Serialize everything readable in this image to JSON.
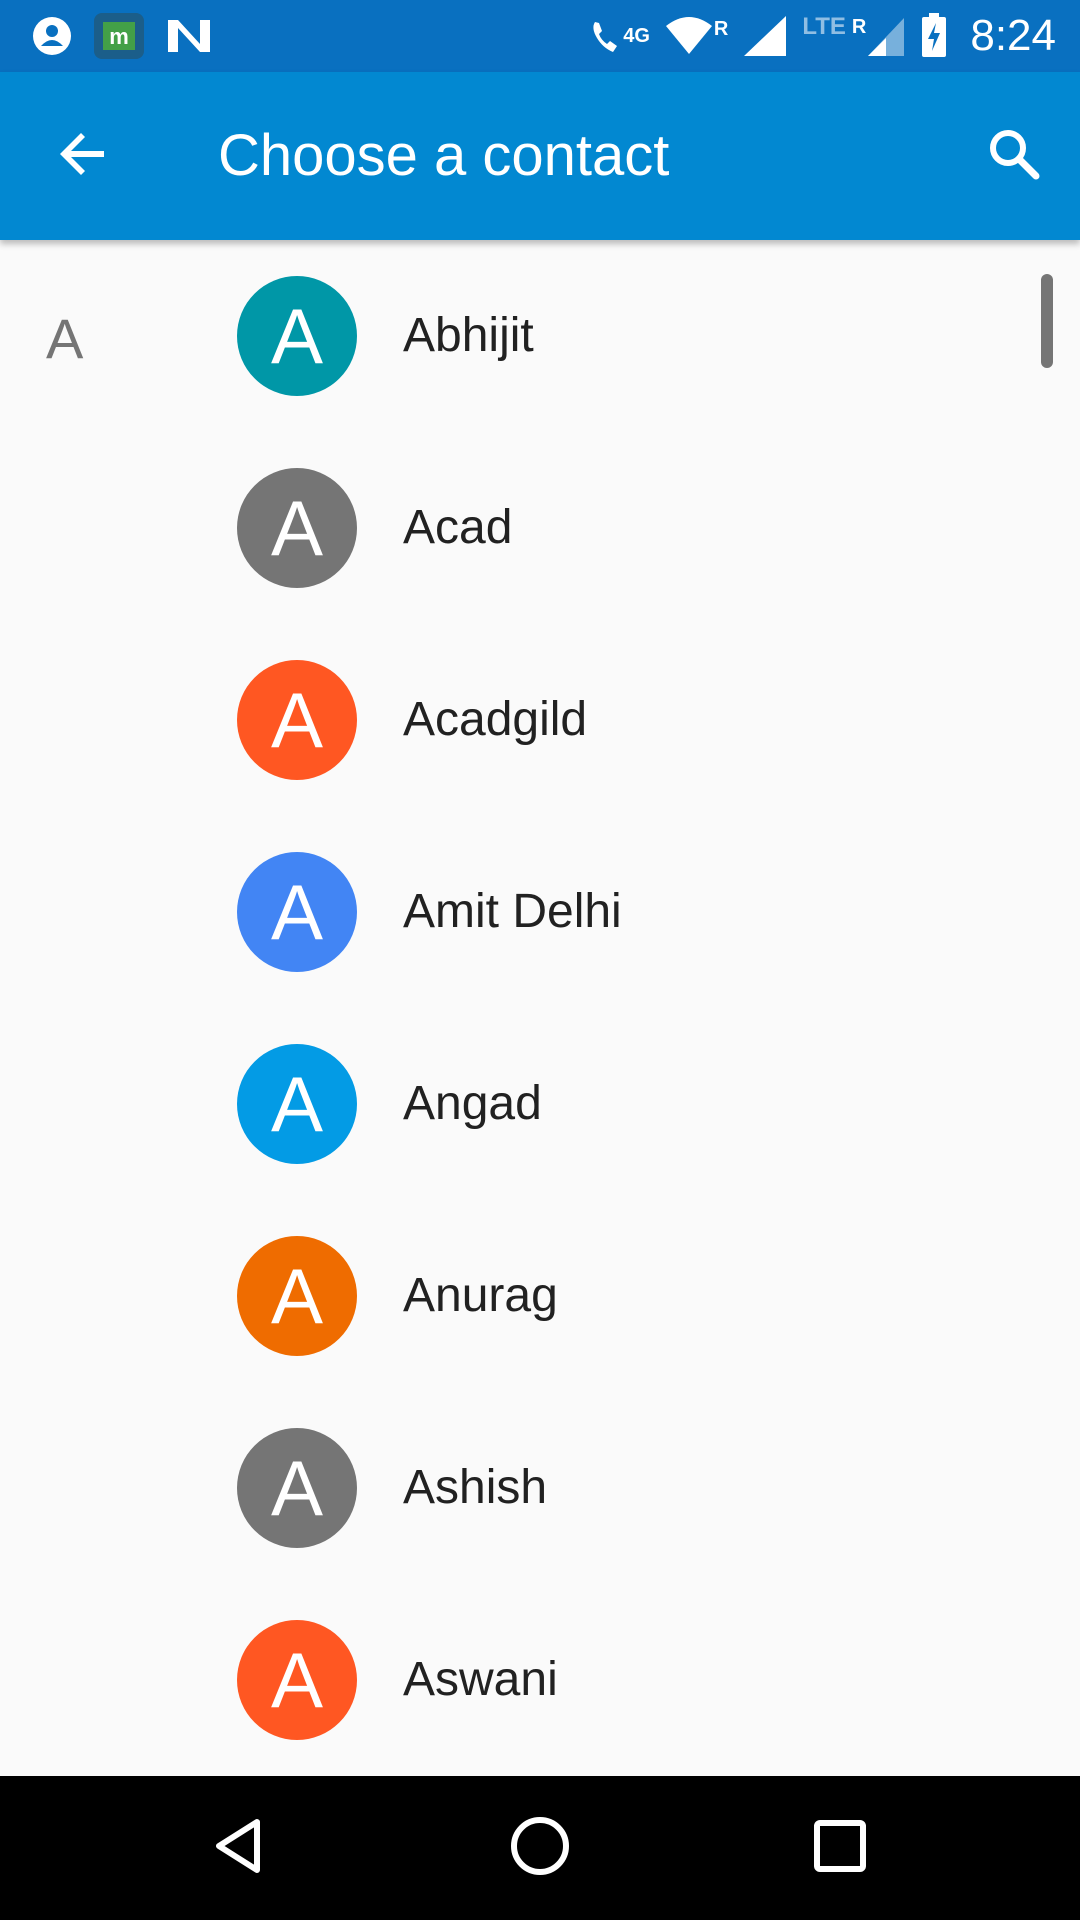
{
  "status_bar": {
    "time": "8:24",
    "network_label": "4G",
    "wifi_roaming": "R",
    "lte_label": "LTE",
    "cell_roaming": "R",
    "left_icons": [
      "account-circle-icon",
      "m-app-icon",
      "n-app-icon"
    ],
    "right_icons": [
      "wifi-calling-icon",
      "wifi-icon",
      "signal-icon",
      "lte-signal-icon",
      "battery-charging-icon"
    ]
  },
  "app_bar": {
    "title": "Choose a contact",
    "back_icon": "arrow-back-icon",
    "search_icon": "search-icon",
    "color": "#0288d1"
  },
  "section": {
    "letter": "A"
  },
  "contacts": [
    {
      "initial": "A",
      "name": "Abhijit",
      "color": "#0097a7"
    },
    {
      "initial": "A",
      "name": "Acad",
      "color": "#757575"
    },
    {
      "initial": "A",
      "name": "Acadgild",
      "color": "#ff5722"
    },
    {
      "initial": "A",
      "name": "Amit Delhi",
      "color": "#4285f4"
    },
    {
      "initial": "A",
      "name": "Angad",
      "color": "#039be5"
    },
    {
      "initial": "A",
      "name": "Anurag",
      "color": "#ef6c00"
    },
    {
      "initial": "A",
      "name": "Ashish",
      "color": "#757575"
    },
    {
      "initial": "A",
      "name": "Aswani",
      "color": "#ff5722"
    }
  ],
  "nav_bar": {
    "icons": [
      "back-triangle-icon",
      "home-circle-icon",
      "recents-square-icon"
    ]
  }
}
